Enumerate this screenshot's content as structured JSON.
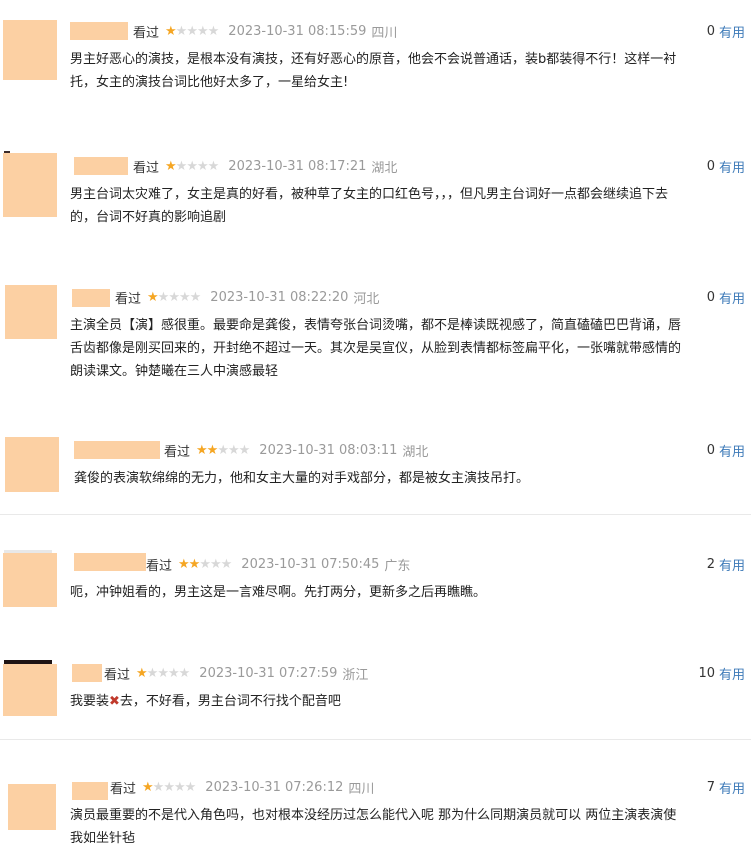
{
  "reviews": [
    {
      "watched": "看过",
      "rating_stars": 1,
      "time": "2023-10-31 08:15:59",
      "location": "四川",
      "useful_count": "0",
      "useful_label": "有用",
      "lines": [
        "男主好恶心的演技，是根本没有演技，还有好恶心的原音，他会不会说普通话，装b都装得不行！这样一衬",
        "托，女主的演技台词比他好太多了，一星给女主!"
      ]
    },
    {
      "watched": "看过",
      "rating_stars": 1,
      "time": "2023-10-31 08:17:21",
      "location": "湖北",
      "useful_count": "0",
      "useful_label": "有用",
      "lines": [
        "男主台词太灾难了，女主是真的好看，被种草了女主的口红色号，，，但凡男主台词好一点都会继续追下去",
        "的，台词不好真的影响追剧"
      ]
    },
    {
      "watched": "看过",
      "rating_stars": 1,
      "time": "2023-10-31 08:22:20",
      "location": "河北",
      "useful_count": "0",
      "useful_label": "有用",
      "lines": [
        "主演全员【演】感很重。最要命是龚俊，表情夸张台词烫嘴，都不是棒读既视感了，简直磕磕巴巴背诵，唇",
        "舌齿都像是刚买回来的，开封绝不超过一天。其次是吴宣仪，从脸到表情都标签扁平化，一张嘴就带感情的",
        "朗读课文。钟楚曦在三人中演感最轻"
      ]
    },
    {
      "watched": "看过",
      "rating_stars": 2,
      "time": "2023-10-31 08:03:11",
      "location": "湖北",
      "useful_count": "0",
      "useful_label": "有用",
      "lines": [
        "龚俊的表演软绵绵的无力，他和女主大量的对手戏部分，都是被女主演技吊打。"
      ]
    },
    {
      "watched": "看过",
      "rating_stars": 2,
      "time": "2023-10-31 07:50:45",
      "location": "广东",
      "useful_count": "2",
      "useful_label": "有用",
      "lines": [
        "呃，冲钟姐看的，男主这是一言难尽啊。先打两分，更新多之后再瞧瞧。"
      ]
    },
    {
      "watched": "看过",
      "rating_stars": 1,
      "time": "2023-10-31 07:27:59",
      "location": "浙江",
      "useful_count": "10",
      "useful_label": "有用",
      "text_pre": "我要装",
      "text_mark": "✖",
      "text_post": "去，不好看，男主台词不行找个配音吧"
    },
    {
      "watched": "看过",
      "rating_stars": 1,
      "time": "2023-10-31 07:26:12",
      "location": "四川",
      "useful_count": "7",
      "useful_label": "有用",
      "lines": [
        "演员最重要的不是代入角色吗，也对根本没经历过怎么能代入呢 那为什么同期演员就可以 两位主演表演使",
        "我如坐针毡"
      ]
    }
  ],
  "colors": {
    "star_on": "#f5a623",
    "star_off": "#d8d8d8",
    "useful_link": "#3d7ab8",
    "avatar_blur": "#fcd0a3"
  }
}
